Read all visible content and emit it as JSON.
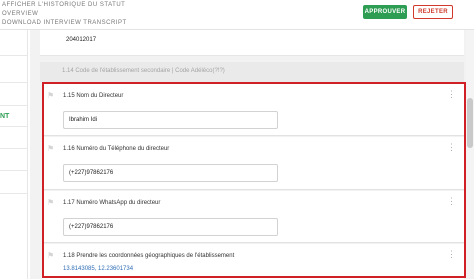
{
  "header": {
    "menu": [
      "AFFICHER L'HISTORIQUE DU STATUT",
      "OVERVIEW",
      "DOWNLOAD INTERVIEW TRANSCRIPT"
    ],
    "approve_label": "APPROUVER",
    "reject_label": "REJETER"
  },
  "left_panel": {
    "partial_text": "NT"
  },
  "previous_answer": "204012017",
  "section_header": "1.14 Code de l'établissement secondaire | Code Adéléco(?!?)",
  "questions": [
    {
      "label": "1.15 Nom du Directeur",
      "answer": "Ibrahim Idi"
    },
    {
      "label": "1.16 Numéro du Téléphone du directeur",
      "answer": "(+227)97862176"
    },
    {
      "label": "1.17 Numéro WhatsApp du directeur",
      "answer": "(+227)97862176"
    },
    {
      "label": "1.18 Prendre les coordonnées géographiques de l'établissement",
      "answer": "13.8143085, 12.23601734"
    }
  ],
  "colors": {
    "approve": "#2e9d54",
    "reject": "#d0392b",
    "highlight": "#d01f25",
    "gps_link": "#2f6db5"
  },
  "icons": {
    "flag": "flag-icon",
    "more": "more-vertical-icon"
  }
}
